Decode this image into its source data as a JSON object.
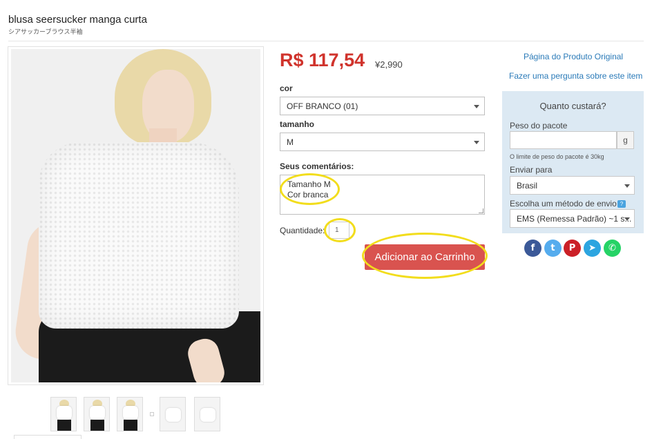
{
  "product": {
    "title": "blusa seersucker manga curta",
    "subtitle": "シアサッカーブラウス半袖",
    "price": "R$ 117,54",
    "original_price": "¥2,990"
  },
  "options": {
    "color_label": "cor",
    "color_value": "OFF BRANCO (01)",
    "size_label": "tamanho",
    "size_value": "M",
    "comments_label": "Seus comentários:",
    "comments_value": "Tamanho M\nCor branca",
    "quantity_label": "Quantidade:",
    "quantity_value": "1",
    "add_to_cart": "Adicionar ao Carrinho"
  },
  "links": {
    "original_page": "Página do Produto Original",
    "ask_question": "Fazer uma pergunta sobre este item"
  },
  "shipping_calc": {
    "title": "Quanto custará?",
    "weight_label": "Peso do pacote",
    "weight_value": "",
    "weight_unit": "g",
    "weight_note": "O limite de peso do pacote é 30kg",
    "ship_to_label": "Enviar para",
    "ship_to_value": "Brasil",
    "method_label": "Escolha um método de envio",
    "method_help": "?",
    "method_value": "EMS (Remessa Padrão) ~1 s..."
  },
  "social": {
    "facebook": {
      "glyph": "f",
      "color": "#3b5998",
      "icon": "facebook-icon"
    },
    "twitter": {
      "glyph": "t",
      "color": "#55acee",
      "icon": "twitter-icon"
    },
    "pinterest": {
      "glyph": "P",
      "color": "#cb2027",
      "icon": "pinterest-icon"
    },
    "telegram": {
      "glyph": "➤",
      "color": "#2ca5e0",
      "icon": "telegram-icon"
    },
    "whatsapp": {
      "glyph": "✆",
      "color": "#25d366",
      "icon": "whatsapp-icon"
    }
  },
  "colors": {
    "price": "#d0332c",
    "cart_button": "#d9534f",
    "link": "#2a7ab8",
    "calc_bg": "#dce9f3",
    "highlight_ring": "#f2dd1c"
  }
}
